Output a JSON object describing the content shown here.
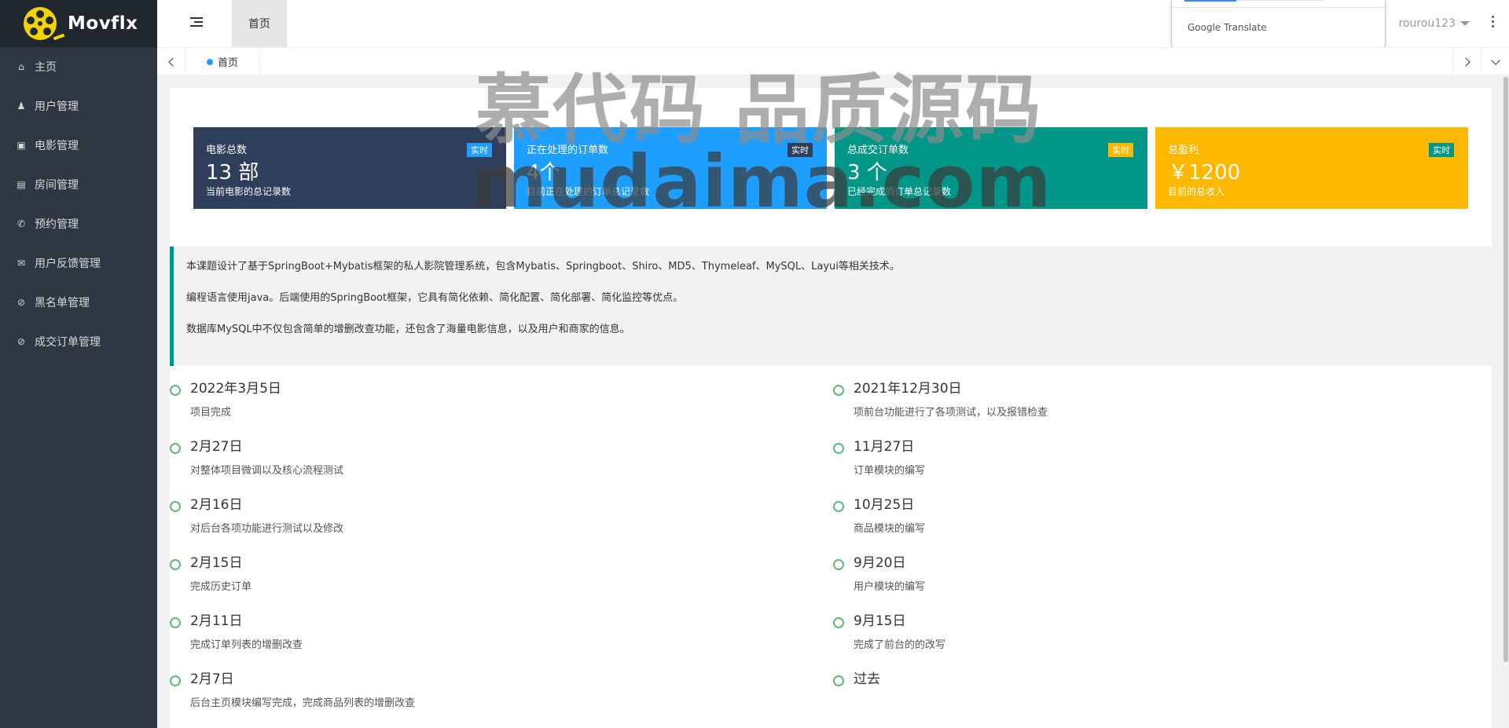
{
  "app": {
    "logo_text": "Movflx"
  },
  "sidebar": {
    "items": [
      {
        "icon": "home-icon",
        "glyph": "⌂",
        "label": "主页"
      },
      {
        "icon": "user-icon",
        "glyph": "♟",
        "label": "用户管理"
      },
      {
        "icon": "film-icon",
        "glyph": "▣",
        "label": "电影管理"
      },
      {
        "icon": "building-icon",
        "glyph": "▤",
        "label": "房间管理"
      },
      {
        "icon": "phone-icon",
        "glyph": "✆",
        "label": "预约管理"
      },
      {
        "icon": "envelope-icon",
        "glyph": "✉",
        "label": "用户反馈管理"
      },
      {
        "icon": "ban-icon",
        "glyph": "⊘",
        "label": "黑名单管理"
      },
      {
        "icon": "ban-icon",
        "glyph": "⊘",
        "label": "成交订单管理"
      }
    ]
  },
  "header": {
    "tab_label": "首页",
    "username": "rourou123",
    "translate_text": "Google Translate"
  },
  "tabbar": {
    "active_tab": "首页"
  },
  "cards": [
    {
      "title": "电影总数",
      "value": "13 部",
      "sub": "当前电影的总记录数",
      "badge": "实时",
      "bg": "#2f3e5a",
      "badge_bg": "#1e9fff"
    },
    {
      "title": "正在处理的订单数",
      "value": "4个",
      "sub": "目前正在处理的订单总记录数",
      "badge": "实时",
      "bg": "#1e9fff",
      "badge_bg": "#2f3e5a"
    },
    {
      "title": "总成交订单数",
      "value": "3 个",
      "sub": "已经完成的订单总记录数",
      "badge": "实时",
      "bg": "#009688",
      "badge_bg": "#ffb800"
    },
    {
      "title": "总盈利",
      "value": "￥1200",
      "sub": "目前的总收入",
      "badge": "实时",
      "bg": "#ffb800",
      "badge_bg": "#009688"
    }
  ],
  "intro": [
    "本课题设计了基于SpringBoot+Mybatis框架的私人影院管理系统，包含Mybatis、Springboot、Shiro、MD5、Thymeleaf、MySQL、Layui等相关技术。",
    "编程语言使用java。后端使用的SpringBoot框架，它具有简化依赖、简化配置、简化部署、简化监控等优点。",
    "数据库MySQL中不仅包含简单的增删改查功能，还包含了海量电影信息，以及用户和商家的信息。"
  ],
  "timeline_left": [
    {
      "date": "2022年3月5日",
      "desc": "项目完成"
    },
    {
      "date": "2月27日",
      "desc": "对整体项目微调以及核心流程测试"
    },
    {
      "date": "2月16日",
      "desc": "对后台各项功能进行测试以及修改"
    },
    {
      "date": "2月15日",
      "desc": "完成历史订单"
    },
    {
      "date": "2月11日",
      "desc": "完成订单列表的增删改查"
    },
    {
      "date": "2月7日",
      "desc": "后台主页模块编写完成，完成商品列表的增删改查"
    }
  ],
  "timeline_right": [
    {
      "date": "2021年12月30日",
      "desc": "项前台功能进行了各项测试，以及报错检查"
    },
    {
      "date": "11月27日",
      "desc": "订单模块的编写"
    },
    {
      "date": "10月25日",
      "desc": "商品模块的编写"
    },
    {
      "date": "9月20日",
      "desc": "用户模块的编写"
    },
    {
      "date": "9月15日",
      "desc": "完成了前台的的改写"
    },
    {
      "date": "过去",
      "desc": ""
    }
  ],
  "watermark": {
    "line1": "慕代码 品质源码",
    "line2": "mudaima.com"
  }
}
